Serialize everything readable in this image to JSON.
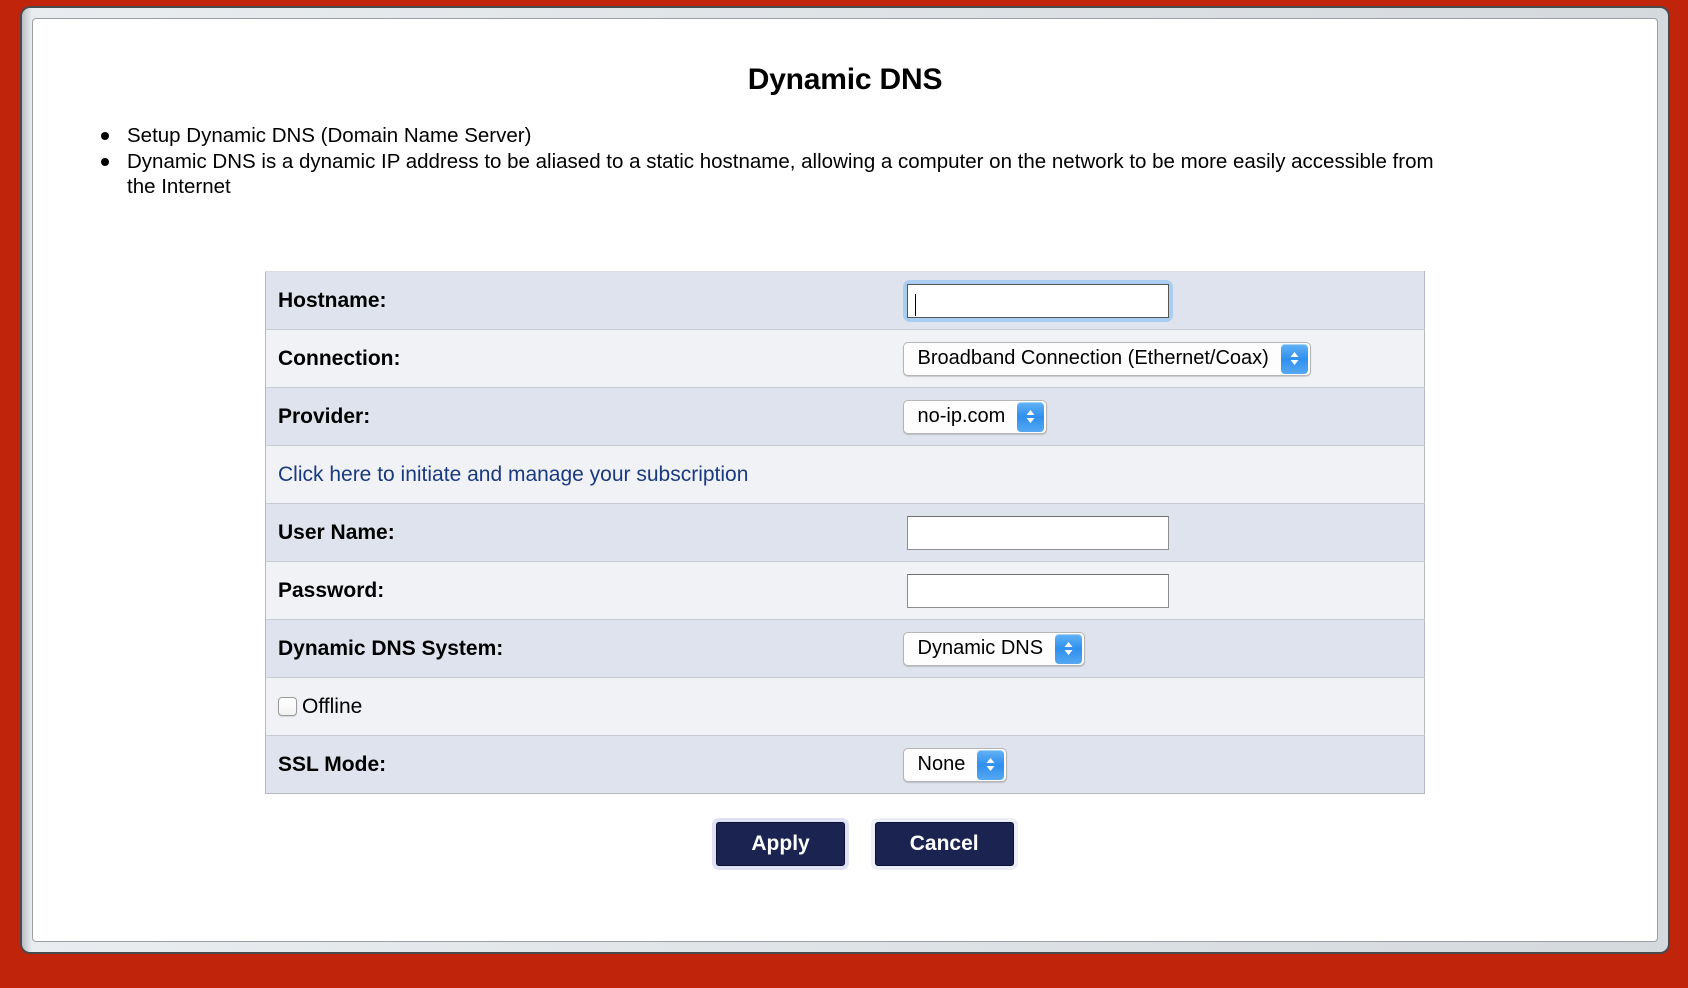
{
  "page": {
    "title": "Dynamic DNS",
    "bullets": [
      "Setup Dynamic DNS (Domain Name Server)",
      "Dynamic DNS is a dynamic IP address to be aliased to a static hostname, allowing a computer on the network to be more easily accessible from the Internet"
    ]
  },
  "form": {
    "hostname": {
      "label": "Hostname:",
      "value": "",
      "placeholder": ""
    },
    "connection": {
      "label": "Connection:",
      "value": "Broadband Connection (Ethernet/Coax)"
    },
    "provider": {
      "label": "Provider:",
      "value": "no-ip.com"
    },
    "subscription_link": "Click here to initiate and manage your subscription",
    "user_name": {
      "label": "User Name:",
      "value": "",
      "placeholder": ""
    },
    "password": {
      "label": "Password:",
      "value": "",
      "placeholder": ""
    },
    "dns_system": {
      "label": "Dynamic DNS System:",
      "value": "Dynamic DNS"
    },
    "offline": {
      "label": "Offline",
      "checked": false
    },
    "ssl_mode": {
      "label": "SSL Mode:",
      "value": "None"
    }
  },
  "buttons": {
    "apply": "Apply",
    "cancel": "Cancel"
  },
  "colors": {
    "desktop": "#c0240a",
    "row_dark": "#dfe3ee",
    "row_light": "#f1f2f6",
    "link": "#1a3a80",
    "button": "#1b2350",
    "stepper": "#2f90ef",
    "focus_ring": "#aacdf2"
  }
}
